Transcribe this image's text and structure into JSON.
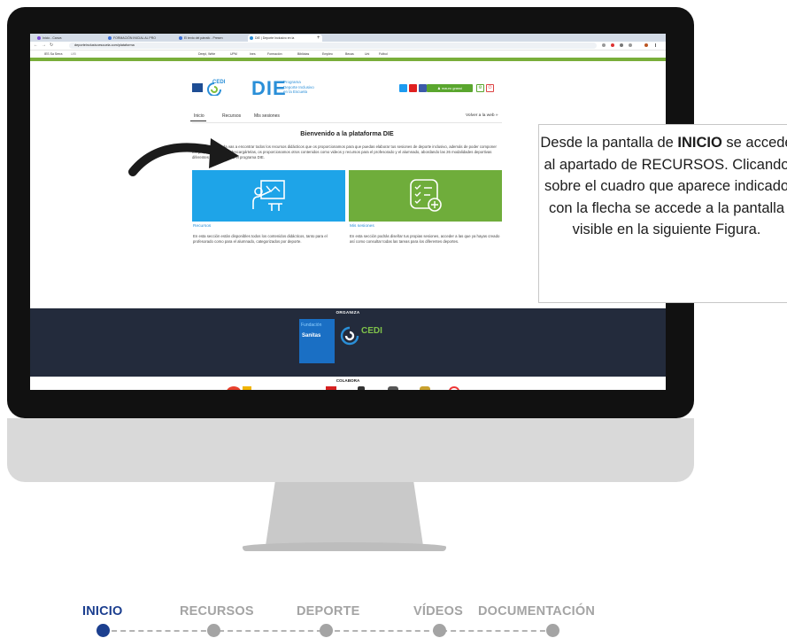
{
  "browser": {
    "tabs": [
      {
        "label": "Inicio - Canva"
      },
      {
        "label": "FORMACIÓN INICIAL AL PRO"
      },
      {
        "label": "El texto del párrafo - Presen"
      },
      {
        "label": "DIE | Deporte Inclusivo en la"
      }
    ],
    "url": "deporteinclusivoescuela.com/plataforma",
    "bookmarks": [
      "IES Sa Serra",
      "UIB",
      "Deepl, Write",
      "UPM",
      "Ines",
      "Formación",
      "Bibliotas",
      "Empleo",
      "Becas",
      "Uni",
      "Fútbol"
    ]
  },
  "site": {
    "cedi_label": "CEDI",
    "die_logo": "DIE",
    "die_subtitle": [
      "Programa",
      "Deporte Inclusivo",
      "en la Escuela"
    ],
    "user_button": "mauro grassi",
    "nav": [
      "Inicio",
      "Recursos",
      "Mis sesiones"
    ],
    "back_link": "Volver a la web »",
    "welcome_title": "Bienvenido a la plataforma DIE",
    "intro_text": "En esta área privada vas a encontrar todos los recursos didácticos que os proporcionamos para que puedas elaborar tus sesiones de deporte inclusivo, además de poder componer tus propias sesiones y descargártelas, os proporcionamos otros contenidos como videos y recursos para el profesorado y el alumnado, abordando las 26 modalidades deportivas diferentes que contempla el programa DIE.",
    "cards": [
      {
        "label": "Recursos",
        "description": "En esta sección están disponibles todos los contenidos didácticos, tanto para el profesorado como para el alumnado, categorizados por deporte.",
        "color": "#1ea4e8"
      },
      {
        "label": "Mis sesiones",
        "description": "En esta sección podrás diseñar tus propias sesiones, acceder a las que ya hayas creado así como consultar todas las tareas para los diferentes deportes.",
        "color": "#6fad3b"
      }
    ],
    "organiza_label": "ORGANIZA",
    "sanitas_line1": "Fundación",
    "sanitas_line2": "Sanitas",
    "cedi_footer": "CEDI",
    "colabora_label": "COLABORA"
  },
  "callout": {
    "text_before": "Desde la pantalla de ",
    "text_bold": "INICIO",
    "text_after": " se accede al apartado de RECURSOS. Clicando sobre el cuadro que aparece indicado con la flecha se accede a la pantalla visible en la siguiente Figura."
  },
  "progress_nav": {
    "items": [
      {
        "label": "INICIO",
        "active": true
      },
      {
        "label": "RECURSOS",
        "active": false
      },
      {
        "label": "DEPORTE",
        "active": false
      },
      {
        "label": "VÍDEOS",
        "active": false
      },
      {
        "label": "DOCUMENTACIÓN",
        "active": false
      }
    ],
    "active_color": "#1c3f8f",
    "inactive_color": "#a4a4a4"
  },
  "icons": [
    "teacher-board-icon",
    "checklist-add-icon",
    "arrow-pointer-icon",
    "twitter-icon",
    "youtube-icon",
    "facebook-icon",
    "user-icon",
    "gear-icon",
    "power-icon"
  ]
}
